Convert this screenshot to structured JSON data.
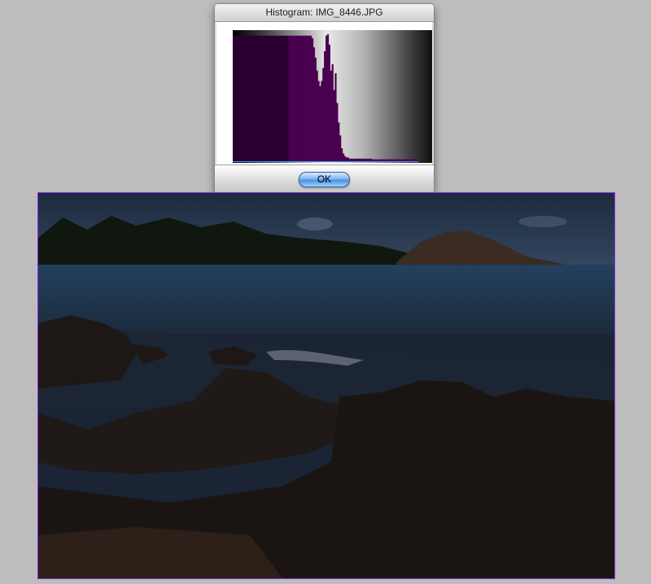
{
  "window": {
    "title": "Histogram: IMG_8446.JPG",
    "ok_label": "OK"
  },
  "histogram": {
    "bar_color": "#4a0050",
    "baseline_color": "#3aa0ff",
    "values": [
      0.97,
      0.97,
      0.97,
      0.97,
      0.97,
      0.97,
      0.97,
      0.97,
      0.97,
      0.97,
      0.97,
      0.97,
      0.97,
      0.97,
      0.97,
      0.97,
      0.97,
      0.97,
      0.97,
      0.97,
      0.97,
      0.97,
      0.97,
      0.97,
      0.97,
      0.97,
      0.97,
      0.97,
      0.97,
      0.97,
      0.97,
      0.97,
      0.97,
      0.97,
      0.97,
      0.97,
      0.97,
      0.97,
      0.97,
      0.97,
      0.97,
      0.97,
      0.97,
      0.97,
      0.97,
      0.97,
      0.97,
      0.97,
      0.97,
      0.97,
      0.97,
      0.95,
      0.88,
      0.8,
      0.7,
      0.62,
      0.58,
      0.62,
      0.72,
      0.85,
      0.97,
      0.98,
      0.9,
      0.7,
      0.75,
      0.55,
      0.68,
      0.45,
      0.3,
      0.2,
      0.1,
      0.06,
      0.04,
      0.03,
      0.03,
      0.02,
      0.02,
      0.02,
      0.02,
      0.02,
      0.02,
      0.02,
      0.02,
      0.02,
      0.02,
      0.02,
      0.02,
      0.02,
      0.02,
      0.02,
      0.015,
      0.015,
      0.015,
      0.015,
      0.015,
      0.015,
      0.015,
      0.015,
      0.015,
      0.015,
      0.015,
      0.015,
      0.015,
      0.015,
      0.015,
      0.015,
      0.015,
      0.015,
      0.015,
      0.015,
      0.015,
      0.015,
      0.015,
      0.015,
      0.015,
      0.015,
      0.015,
      0.015,
      0.015,
      0.015
    ]
  },
  "photo": {
    "border_color": "#8a2be2",
    "sky_color": "#2b3d55",
    "water_color": "#1e3248",
    "rock_color": "#1b1614",
    "sand_color": "#3a2a1e"
  }
}
